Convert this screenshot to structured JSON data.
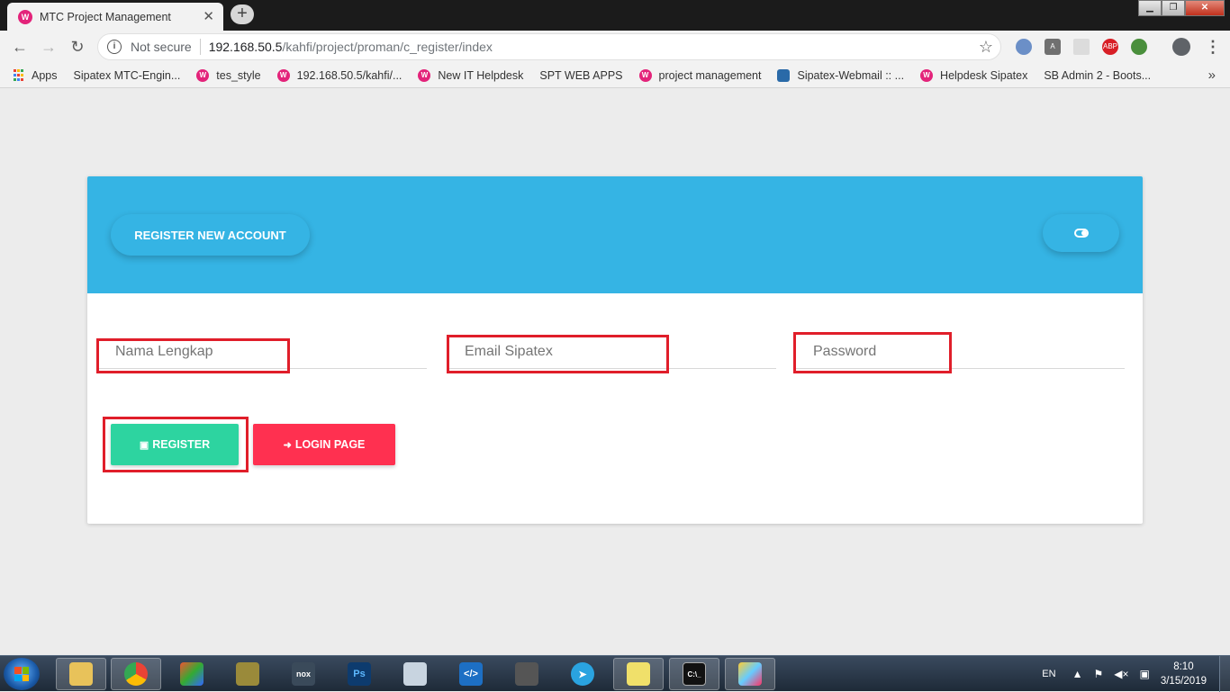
{
  "browser": {
    "tab_title": "MTC Project Management",
    "favicon_letter": "W",
    "security_label": "Not secure",
    "url_host": "192.168.50.5",
    "url_path": "/kahfi/project/proman/c_register/index"
  },
  "bookmarks": [
    {
      "label": "Apps",
      "icon": "apps-grid-icon"
    },
    {
      "label": "Sipatex MTC-Engin...",
      "icon": "page-icon"
    },
    {
      "label": "tes_style",
      "icon": "wamp-icon"
    },
    {
      "label": "192.168.50.5/kahfi/...",
      "icon": "wamp-icon"
    },
    {
      "label": "New IT Helpdesk",
      "icon": "wamp-icon"
    },
    {
      "label": "SPT WEB APPS",
      "icon": "page-icon"
    },
    {
      "label": "project management",
      "icon": "wamp-icon"
    },
    {
      "label": "Sipatex-Webmail :: ...",
      "icon": "mail-icon"
    },
    {
      "label": "Helpdesk Sipatex",
      "icon": "wamp-icon"
    },
    {
      "label": "SB Admin 2 - Boots...",
      "icon": "page-icon"
    }
  ],
  "form": {
    "header_title": "REGISTER NEW ACCOUNT",
    "fields": {
      "name_placeholder": "Nama Lengkap",
      "email_placeholder": "Email Sipatex",
      "password_placeholder": "Password"
    },
    "register_label": "REGISTER",
    "login_label": "LOGIN PAGE"
  },
  "colors": {
    "header": "#35b4e4",
    "register": "#2dd4a0",
    "login": "#ff3050",
    "highlight": "#e01e2a"
  },
  "taskbar": {
    "lang": "EN",
    "time": "8:10",
    "date": "3/15/2019"
  }
}
